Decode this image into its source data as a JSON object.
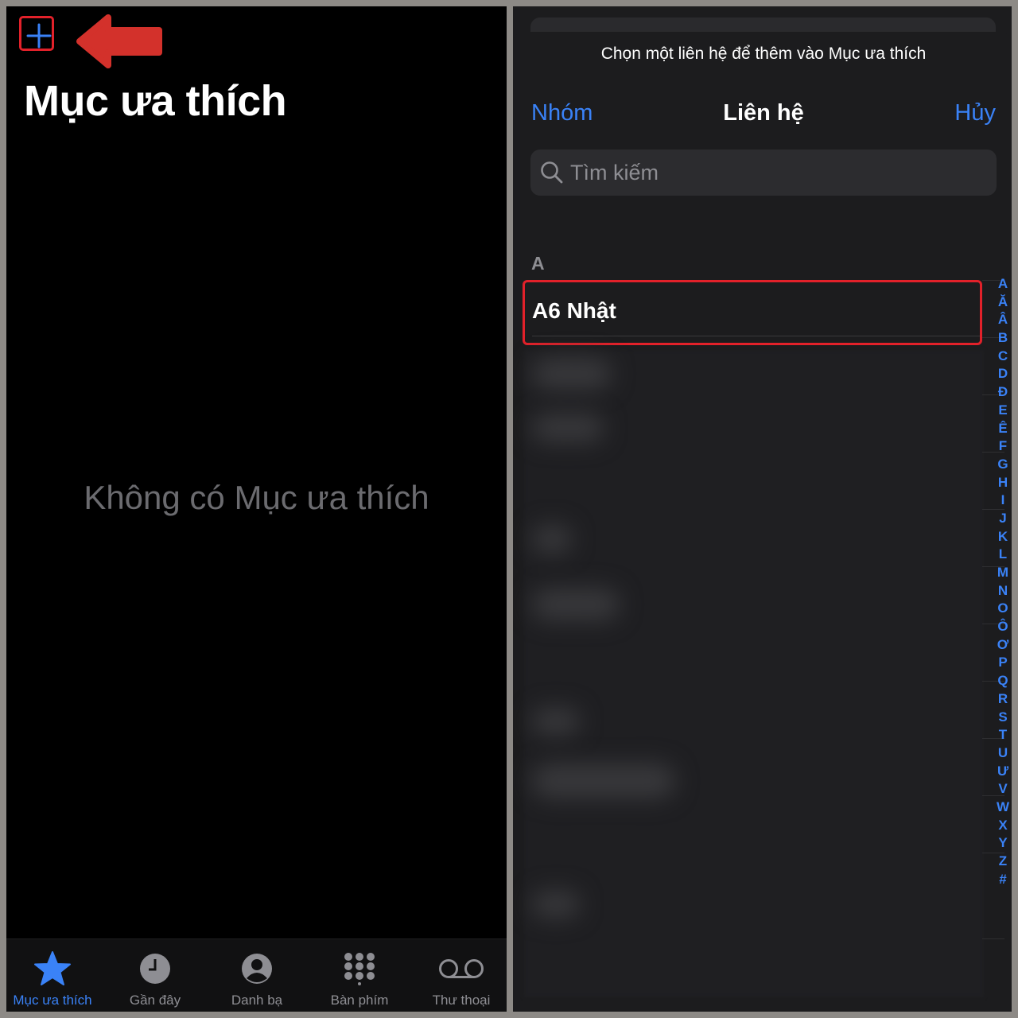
{
  "left": {
    "title": "Mục ưa thích",
    "empty_message": "Không có Mục ưa thích",
    "tabs": [
      {
        "label": "Mục ưa thích",
        "icon": "star-icon",
        "active": true
      },
      {
        "label": "Gần đây",
        "icon": "clock-icon",
        "active": false
      },
      {
        "label": "Danh bạ",
        "icon": "person-circle-icon",
        "active": false
      },
      {
        "label": "Bàn phím",
        "icon": "keypad-icon",
        "active": false
      },
      {
        "label": "Thư thoại",
        "icon": "voicemail-icon",
        "active": false
      }
    ]
  },
  "right": {
    "prompt": "Chọn một liên hệ để thêm vào Mục ưa thích",
    "nav": {
      "left": "Nhóm",
      "title": "Liên hệ",
      "right": "Hủy"
    },
    "search": {
      "placeholder": "Tìm kiếm"
    },
    "section": "A",
    "contacts": [
      {
        "name": "A6 Nhật"
      }
    ],
    "index": [
      "A",
      "Ă",
      "Â",
      "B",
      "C",
      "D",
      "Đ",
      "E",
      "Ê",
      "F",
      "G",
      "H",
      "I",
      "J",
      "K",
      "L",
      "M",
      "N",
      "O",
      "Ô",
      "Ơ",
      "P",
      "Q",
      "R",
      "S",
      "T",
      "U",
      "Ư",
      "V",
      "W",
      "X",
      "Y",
      "Z",
      "#"
    ]
  },
  "colors": {
    "accent": "#3a82f7",
    "highlight": "#e2212a",
    "background": "#000000"
  }
}
